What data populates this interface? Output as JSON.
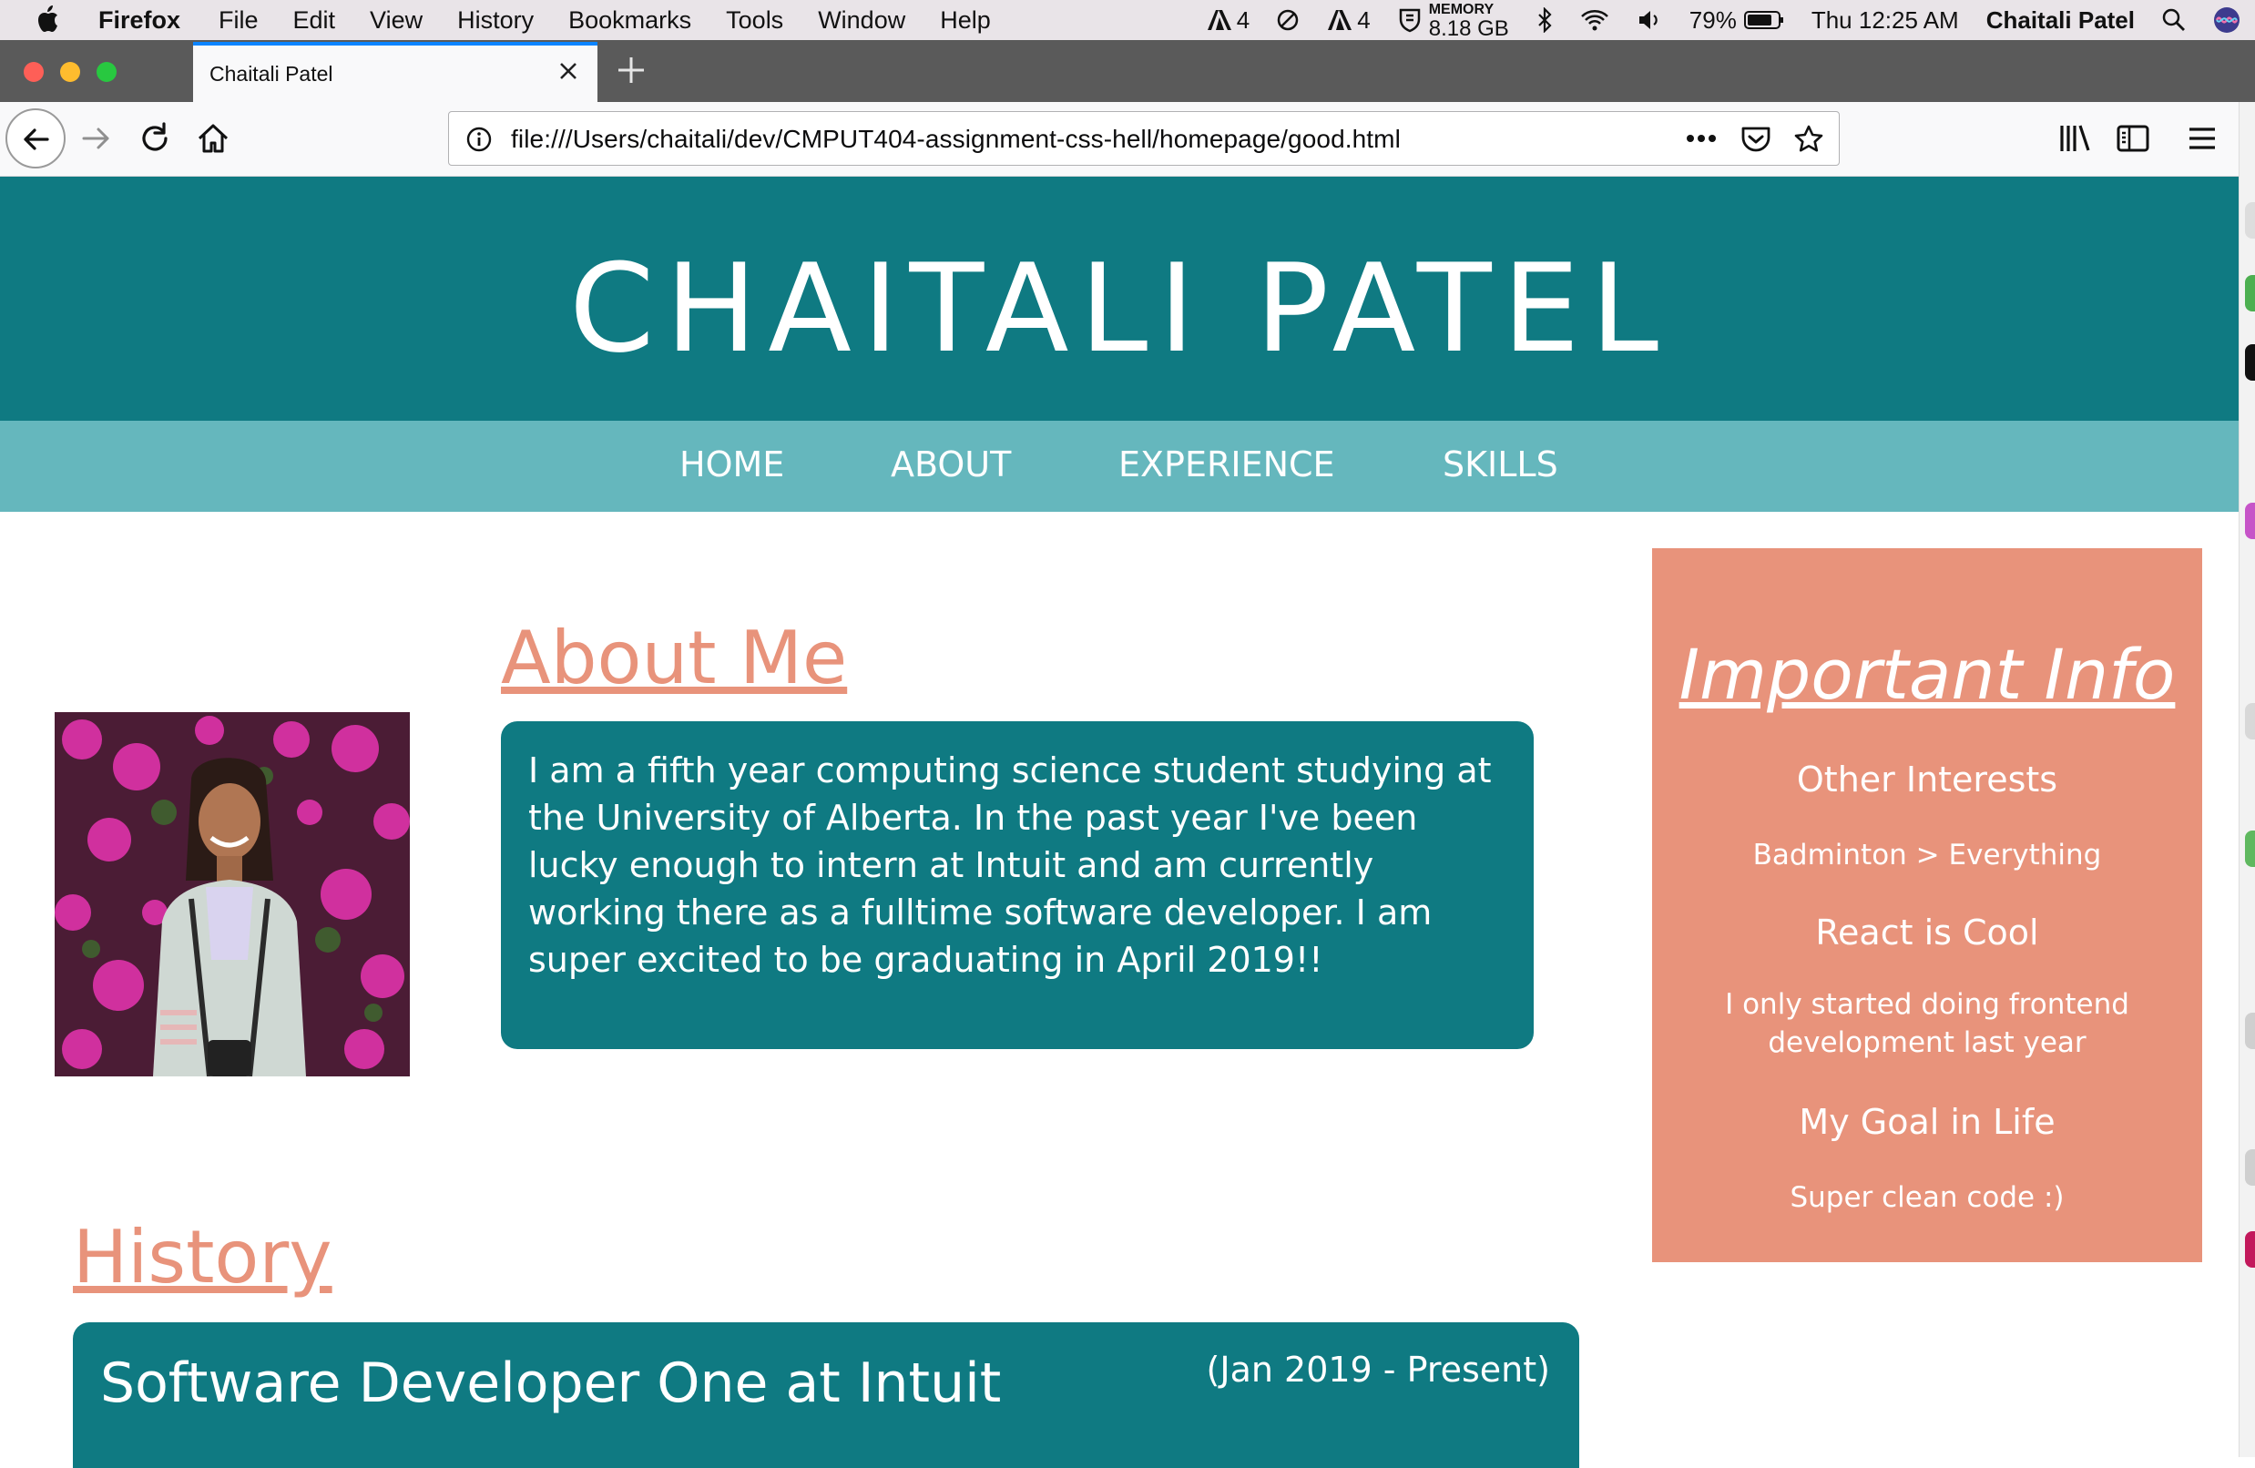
{
  "menubar": {
    "app_name": "Firefox",
    "menus": [
      "File",
      "Edit",
      "View",
      "History",
      "Bookmarks",
      "Tools",
      "Window",
      "Help"
    ],
    "status": {
      "adobe_count_1": "4",
      "adobe_count_2": "4",
      "memory_label": "MEMORY",
      "memory_value": "8.18 GB",
      "battery": "79%",
      "clock": "Thu 12:25 AM",
      "user": "Chaitali Patel"
    }
  },
  "browser": {
    "tab_title": "Chaitali Patel",
    "url": "file:///Users/chaitali/dev/CMPUT404-assignment-css-hell/homepage/good.html"
  },
  "page": {
    "site_title": "CHAITALI PATEL",
    "nav": [
      "HOME",
      "ABOUT",
      "EXPERIENCE",
      "SKILLS"
    ],
    "about": {
      "heading": "About Me",
      "text": "I am a fifth year computing science student studying at the University of Alberta. In the past year I've been lucky enough to intern at Intuit and am currently working there as a fulltime software developer. I am super excited to be graduating in April 2019!!"
    },
    "history": {
      "heading": "History",
      "jobs": [
        {
          "role": "Software Developer One at Intuit",
          "dates": "(Jan 2019 - Present)"
        }
      ]
    },
    "sidebar": {
      "title": "Important Info",
      "sections": [
        {
          "heading": "Other Interests",
          "text": "Badminton > Everything"
        },
        {
          "heading": "React is Cool",
          "text": "I only started doing frontend development last year"
        },
        {
          "heading": "My Goal in Life",
          "text": "Super clean code :)"
        }
      ]
    }
  },
  "colors": {
    "teal": "#0f7a82",
    "nav_teal": "#65b7bd",
    "salmon": "#e8937b",
    "white": "#ffffff"
  }
}
